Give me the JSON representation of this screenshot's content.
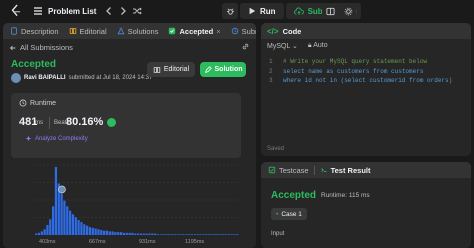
{
  "topbar": {
    "problem_list_label": "Problem List",
    "run_label": "Run",
    "submit_label": "Submit"
  },
  "left_tabs": [
    {
      "label": "Description"
    },
    {
      "label": "Editorial"
    },
    {
      "label": "Solutions"
    },
    {
      "label": "Accepted"
    },
    {
      "label": "Submissions"
    }
  ],
  "submission": {
    "back_label": "All Submissions",
    "status": "Accepted",
    "user": "Ravi BAIPALLI",
    "submitted_text": "submitted at Jul 18, 2024 14:37",
    "editorial_button": "Editorial",
    "solution_button": "Solution"
  },
  "runtime": {
    "label": "Runtime",
    "value": "481",
    "unit": "ms",
    "beats_label": "Beats",
    "beats_value": "80.16%",
    "analyze_label": "Analyze Complexity"
  },
  "chart_data": {
    "type": "bar",
    "x_tick_labels": [
      "403ms",
      "667ms",
      "931ms",
      "1195ms"
    ],
    "values": [
      2,
      3,
      5,
      8,
      14,
      22,
      40,
      95,
      72,
      58,
      48,
      40,
      34,
      29,
      25,
      21,
      18,
      15,
      13,
      11,
      10,
      9,
      8,
      7,
      6,
      6,
      5,
      5,
      4,
      4,
      4,
      3,
      3,
      3,
      3,
      2,
      2,
      2,
      2,
      2,
      2,
      2,
      2,
      1,
      1,
      1,
      1,
      1,
      1,
      1,
      1,
      1,
      1,
      1,
      1,
      1,
      1,
      1,
      1,
      1,
      1,
      1,
      1,
      1,
      1,
      1,
      1,
      1,
      1,
      1,
      1,
      1
    ],
    "highlight_index": 9,
    "color_bar": "#2e6be6",
    "color_grid": "#3d3d3d"
  },
  "code": {
    "title": "Code",
    "language": "MySQL",
    "mode": "Auto",
    "lines": [
      {
        "num": "1",
        "text": "# Write your MySQL query statement below"
      },
      {
        "num": "2",
        "text": "select name as customers from customers"
      },
      {
        "num": "3",
        "text": "where id not in (select customerid from orders)"
      }
    ],
    "saved_label": "Saved"
  },
  "test": {
    "tab_testcase": "Testcase",
    "tab_result": "Test Result",
    "status": "Accepted",
    "runtime_text": "Runtime: 115 ms",
    "case_label": "Case 1",
    "input_label": "Input"
  },
  "colors": {
    "accent_green": "#2cbb5d",
    "purple": "#8d7cf2",
    "panel_bg": "#262626",
    "app_bg": "#1a1a1a"
  }
}
